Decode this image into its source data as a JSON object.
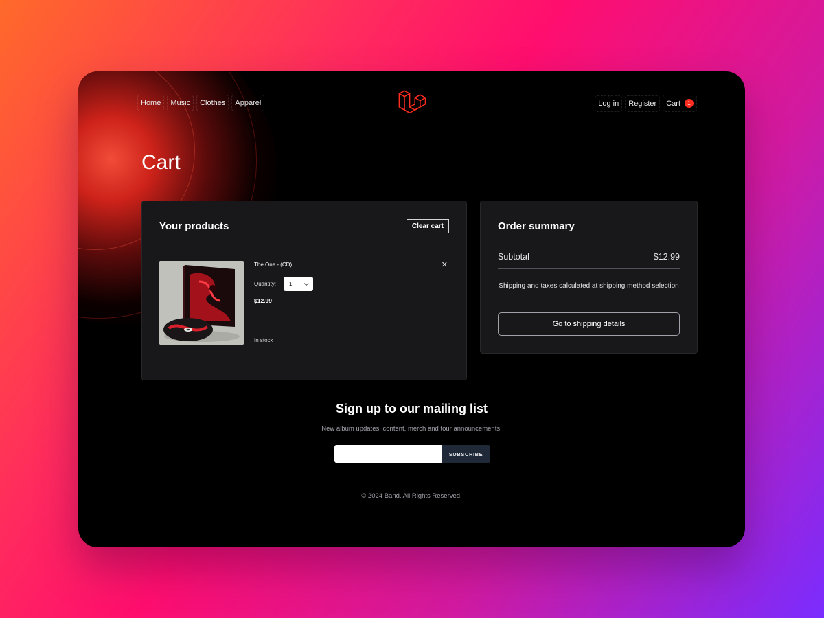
{
  "nav": {
    "left": [
      "Home",
      "Music",
      "Clothes",
      "Apparel"
    ],
    "login": "Log in",
    "register": "Register",
    "cart": "Cart",
    "cart_count": "1"
  },
  "page": {
    "title": "Cart"
  },
  "products_panel": {
    "title": "Your products",
    "clear_label": "Clear cart",
    "items": [
      {
        "name": "The One - (CD)",
        "quantity_label": "Quantity:",
        "quantity": "1",
        "price": "$12.99",
        "stock": "In stock",
        "remove": "✕"
      }
    ]
  },
  "summary": {
    "title": "Order summary",
    "subtotal_label": "Subtotal",
    "subtotal_value": "$12.99",
    "note": "Shipping and taxes calculated at shipping method selection",
    "button": "Go to shipping details"
  },
  "mailing": {
    "title": "Sign up to our mailing list",
    "subtitle": "New album updates, content, merch and tour announcements.",
    "input_placeholder": "",
    "button": "SUBSCRIBE"
  },
  "footer": {
    "text": "© 2024 Band. All Rights Reserved."
  },
  "colors": {
    "accent": "#ff2d20",
    "panel": "#18181b",
    "background": "#000000"
  }
}
